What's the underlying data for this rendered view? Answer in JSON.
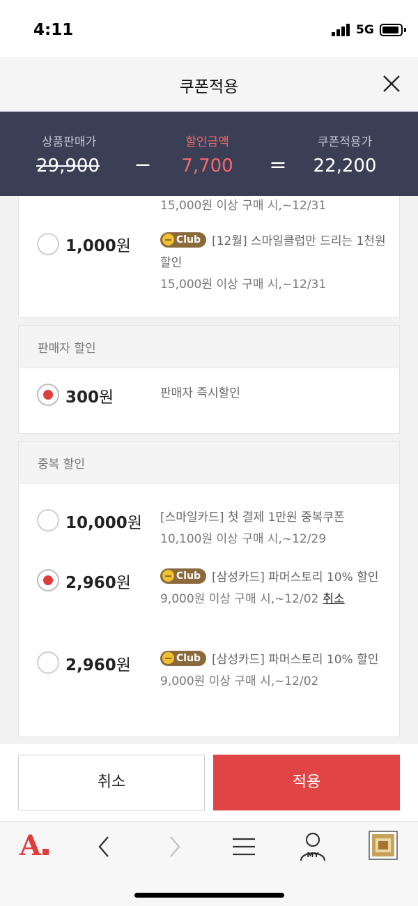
{
  "status": {
    "time": "4:11",
    "network": "5G"
  },
  "header": {
    "title": "쿠폰적용"
  },
  "summary": {
    "original_label": "상품판매가",
    "original_value": "29,900",
    "discount_label": "할인금액",
    "discount_value": "7,700",
    "final_label": "쿠폰적용가",
    "final_value": "22,200",
    "minus": "−",
    "equals": "="
  },
  "coupons_top": {
    "partial_condition": "15,000원 이상 구매 시,~12/31",
    "item": {
      "amount": "1,000",
      "won": "원",
      "badge": "Club",
      "title": "[12월] 스마일클럽만 드리는 1천원 할인",
      "condition": "15,000원 이상 구매 시,~12/31",
      "checked": false
    }
  },
  "seller_section": {
    "title": "판매자 할인",
    "item": {
      "amount": "300",
      "won": "원",
      "title": "판매자 즉시할인",
      "checked": true
    }
  },
  "stack_section": {
    "title": "중복 할인",
    "items": [
      {
        "amount": "10,000",
        "won": "원",
        "title": "[스마일카드] 첫 결제 1만원 중복쿠폰",
        "condition": "10,100원 이상 구매 시,~12/29",
        "checked": false
      },
      {
        "amount": "2,960",
        "won": "원",
        "badge": "Club",
        "title": "[삼성카드] 파머스토리 10% 할인",
        "condition": "9,000원 이상 구매 시,~12/02",
        "cancel": "취소",
        "checked": true
      },
      {
        "amount": "2,960",
        "won": "원",
        "badge": "Club",
        "title": "[삼성카드] 파머스토리 10% 할인",
        "condition": "9,000원 이상 구매 시,~12/02",
        "checked": false
      }
    ]
  },
  "actions": {
    "cancel": "취소",
    "apply": "적용"
  },
  "nav": {
    "logo": "A",
    "my_label": "MY"
  },
  "colors": {
    "accent": "#e04444",
    "summary_bg": "#3b3f56",
    "club_badge": "#8a6a3c"
  }
}
